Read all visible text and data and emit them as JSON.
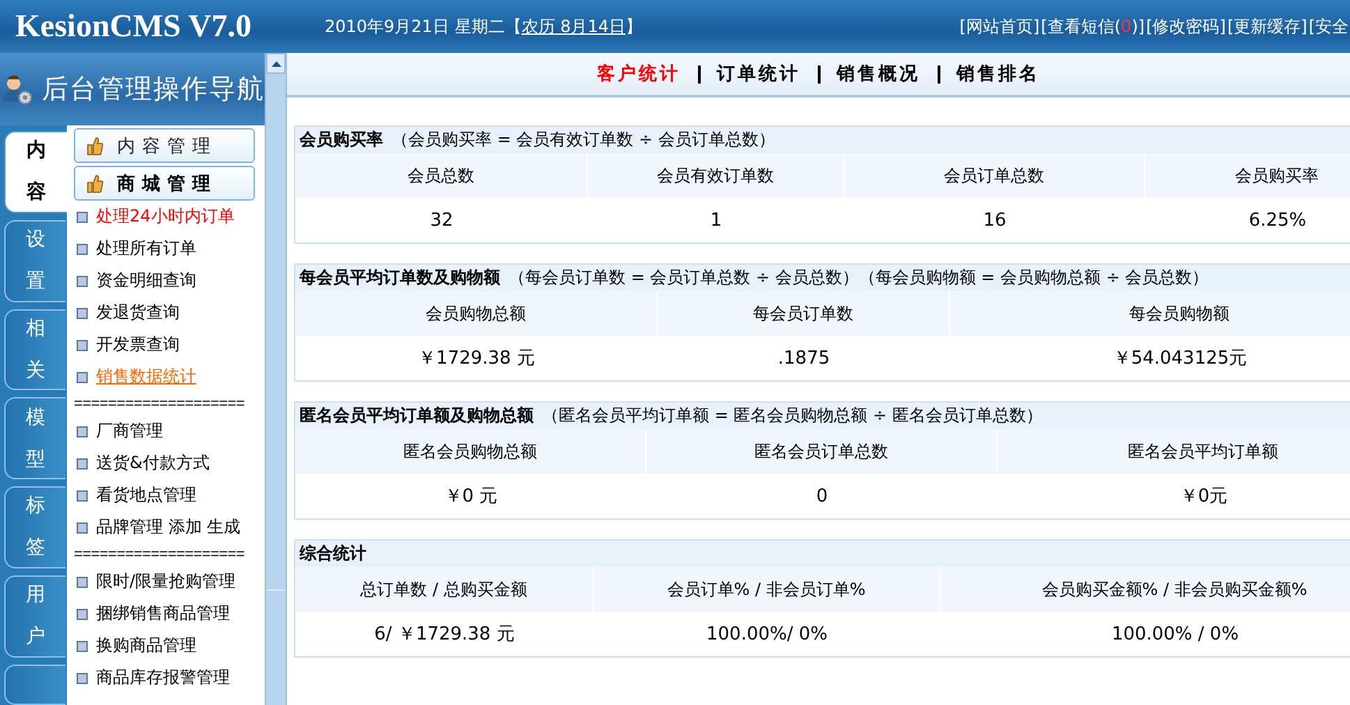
{
  "header": {
    "logo": "KesionCMS V7.0",
    "date": "2010年9月21日 星期二【",
    "lunar_link": "农历 8月14日",
    "date_end": "】",
    "links": [
      {
        "text": "[网站首页]"
      },
      {
        "text": "[查看短信(",
        "count": "0",
        "tail": ")]"
      },
      {
        "text": "[修改密码]"
      },
      {
        "text": "[更新缓存]"
      },
      {
        "text": "[安全"
      }
    ]
  },
  "sidebar": {
    "nav_title": "后台管理操作导航",
    "tabs": [
      {
        "label": "内容",
        "selected": true
      },
      {
        "label": "设置",
        "selected": false
      },
      {
        "label": "相关",
        "selected": false
      },
      {
        "label": "模型",
        "selected": false
      },
      {
        "label": "标签",
        "selected": false
      },
      {
        "label": "用户",
        "selected": false
      }
    ],
    "menu_headers": [
      {
        "label": "内容管理",
        "selected": false
      },
      {
        "label": "商城管理",
        "selected": true
      }
    ],
    "items": [
      {
        "kind": "link",
        "label": "处理24小时内订单",
        "highlight": true,
        "selected": false
      },
      {
        "kind": "link",
        "label": "处理所有订单",
        "highlight": false,
        "selected": false
      },
      {
        "kind": "link",
        "label": "资金明细查询",
        "highlight": false,
        "selected": false
      },
      {
        "kind": "link",
        "label": "发退货查询",
        "highlight": false,
        "selected": false
      },
      {
        "kind": "link",
        "label": "开发票查询",
        "highlight": false,
        "selected": false
      },
      {
        "kind": "link",
        "label": "销售数据统计",
        "highlight": false,
        "selected": true
      },
      {
        "kind": "separator",
        "label": "===================="
      },
      {
        "kind": "link",
        "label": "厂商管理",
        "highlight": false,
        "selected": false
      },
      {
        "kind": "link",
        "label": "送货&付款方式",
        "highlight": false,
        "selected": false
      },
      {
        "kind": "link",
        "label": "看货地点管理",
        "highlight": false,
        "selected": false
      },
      {
        "kind": "link",
        "label": "品牌管理 添加 生成",
        "highlight": false,
        "selected": false
      },
      {
        "kind": "separator",
        "label": "===================="
      },
      {
        "kind": "link",
        "label": "限时/限量抢购管理",
        "highlight": false,
        "selected": false
      },
      {
        "kind": "link",
        "label": "捆绑销售商品管理",
        "highlight": false,
        "selected": false
      },
      {
        "kind": "link",
        "label": "换购商品管理",
        "highlight": false,
        "selected": false
      },
      {
        "kind": "link",
        "label": "商品库存报警管理",
        "highlight": false,
        "selected": false
      }
    ]
  },
  "main": {
    "tabs": [
      {
        "label": "客户统计",
        "selected": true
      },
      {
        "label": "订单统计",
        "selected": false
      },
      {
        "label": "销售概况",
        "selected": false
      },
      {
        "label": "销售排名",
        "selected": false
      }
    ],
    "sections": [
      {
        "title": "会员购买率",
        "formula": "（会员购买率 = 会员有效订单数 ÷ 会员订单总数）",
        "columns": [
          "会员总数",
          "会员有效订单数",
          "会员订单总数",
          "会员购买率"
        ],
        "values": [
          "32",
          "1",
          "16",
          "6.25%"
        ]
      },
      {
        "title": "每会员平均订单数及购物额",
        "formula": "（每会员订单数 = 会员订单总数 ÷ 会员总数）（每会员购物额 = 会员购物总额 ÷ 会员总数）",
        "columns": [
          "会员购物总额",
          "每会员订单数",
          "每会员购物额"
        ],
        "values": [
          "￥1729.38 元",
          ".1875",
          "￥54.043125元"
        ]
      },
      {
        "title": "匿名会员平均订单额及购物总额",
        "formula": "（匿名会员平均订单额 = 匿名会员购物总额 ÷ 匿名会员订单总数）",
        "columns": [
          "匿名会员购物总额",
          "匿名会员订单总数",
          "匿名会员平均订单额"
        ],
        "values": [
          "￥0 元",
          "0",
          "￥0元"
        ]
      },
      {
        "title": "综合统计",
        "columns": [
          "总订单数 / 总购买金额",
          "会员订单% / 非会员订单%",
          "会员购买金额% / 非会员购买金额%"
        ],
        "values": [
          "6/ ￥1729.38 元",
          "100.00%/ 0%",
          "100.00% / 0%"
        ]
      }
    ]
  }
}
